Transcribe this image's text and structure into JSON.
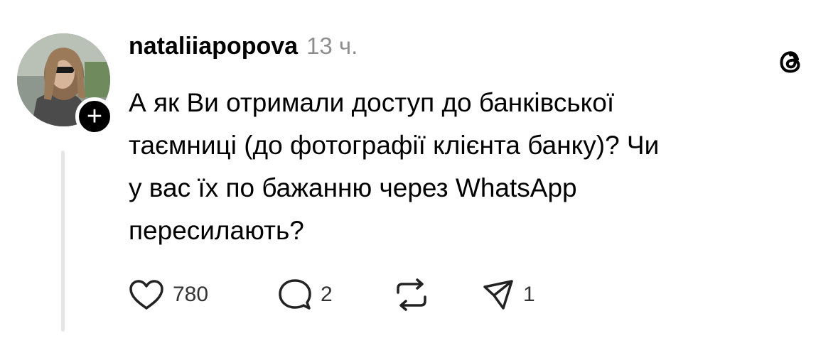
{
  "post": {
    "username": "nataliiapopova",
    "timestamp": "13 ч.",
    "text": "А як Ви отримали доступ до банківської\nтаємниці (до фотографії клієнта банку)? Чи\nу вас їх по бажанню через WhatsApp\nпересилають?"
  },
  "follow_badge": "+",
  "actions": {
    "like_count": "780",
    "reply_count": "2",
    "share_count": "1"
  },
  "icons": [
    "threads-logo-icon",
    "heart-icon",
    "comment-icon",
    "repost-icon",
    "share-icon",
    "plus-icon"
  ]
}
